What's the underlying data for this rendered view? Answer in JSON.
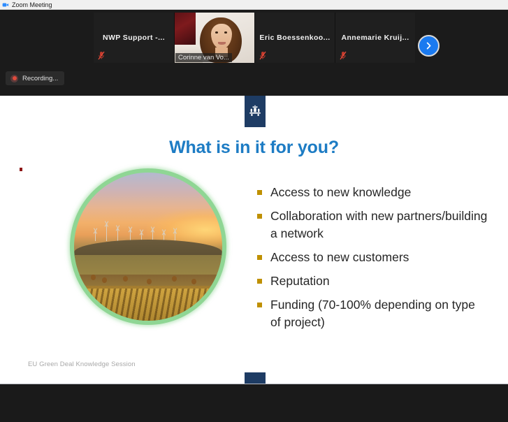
{
  "window": {
    "title": "Zoom Meeting",
    "icon": "zoom-camera-icon"
  },
  "filmstrip": {
    "participants": [
      {
        "name": "NWP Support  -...",
        "has_video": false,
        "muted": true
      },
      {
        "name": "Corinne van Vo...",
        "has_video": true,
        "muted": false
      },
      {
        "name": "Eric  Boessenkoo...",
        "has_video": false,
        "muted": true
      },
      {
        "name": "Annemarie  Kruij...",
        "has_video": false,
        "muted": true
      }
    ],
    "next_button_label": "›"
  },
  "recording": {
    "label": "Recording...",
    "dot_color": "#e04b3c"
  },
  "slide": {
    "title": "What is in it for you?",
    "title_color": "#1d7cc4",
    "logo_name": "rijksoverheid-logo",
    "logo_color": "#1e3c64",
    "bullet_color": "#bf9000",
    "bullets": [
      "Access to new knowledge",
      "Collaboration with new partners/building a network",
      "Access to new customers",
      "Reputation",
      "Funding (70-100% depending on type of project)"
    ],
    "image_alt": "Sunset landscape with wind turbines over vineyard fields",
    "image_ring_color": "#8fd694",
    "footer": "EU Green Deal Knowledge Session"
  }
}
